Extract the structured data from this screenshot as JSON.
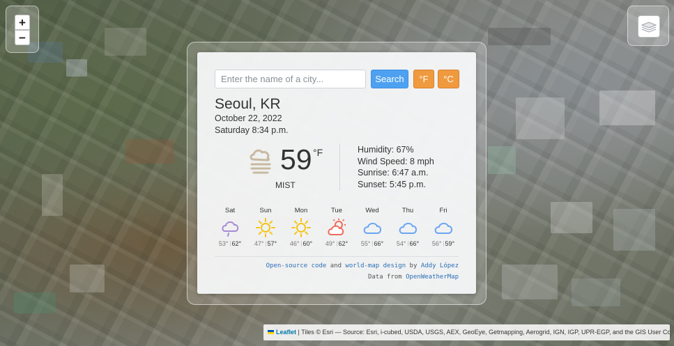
{
  "map": {
    "zoom_in": "+",
    "zoom_out": "−",
    "attribution": {
      "leaflet_label": "Leaflet",
      "text": "| Tiles © Esri — Source: Esri, i-cubed, USDA, USGS, AEX, GeoEye, Getmapping, Aerogrid, IGN, IGP, UPR-EGP, and the GIS User Community"
    }
  },
  "search": {
    "placeholder": "Enter the name of a city...",
    "value": "",
    "button_label": "Search",
    "fahrenheit_label": "°F",
    "celsius_label": "°C"
  },
  "current": {
    "city": "Seoul, KR",
    "date": "October 22, 2022",
    "time": "Saturday 8:34 p.m.",
    "temperature": "59",
    "unit": "°F",
    "description": "MIST",
    "icon": "mist-icon",
    "humidity": "Humidity: 67%",
    "wind": "Wind Speed: 8 mph",
    "sunrise": "Sunrise: 6:47 a.m.",
    "sunset": "Sunset: 5:45 p.m."
  },
  "forecast": [
    {
      "day": "Sat",
      "icon": "rain-cloud-icon",
      "low": "53°",
      "high": "62°"
    },
    {
      "day": "Sun",
      "icon": "sun-icon",
      "low": "47°",
      "high": "57°"
    },
    {
      "day": "Mon",
      "icon": "sun-icon",
      "low": "46°",
      "high": "60°"
    },
    {
      "day": "Tue",
      "icon": "partly-cloudy-icon",
      "low": "49°",
      "high": "62°"
    },
    {
      "day": "Wed",
      "icon": "cloud-icon",
      "low": "55°",
      "high": "66°"
    },
    {
      "day": "Thu",
      "icon": "cloud-icon",
      "low": "54°",
      "high": "66°"
    },
    {
      "day": "Fri",
      "icon": "cloud-icon",
      "low": "56°",
      "high": "59°"
    }
  ],
  "credits": {
    "source_code": "Open-source code",
    "and": "and",
    "design": "world-map design",
    "by": "by",
    "author": "Addy López",
    "data_from": "Data from",
    "provider": "OpenWeatherMap"
  },
  "colors": {
    "search_button": "#4ea1f0",
    "unit_buttons": "#ef9a3e",
    "mist_icon": "#c8b9a0",
    "sun_icon": "#f5c518",
    "cloud_icon": "#6aa6f2",
    "rain_icon": "#a78bd6",
    "partly_cloudy_icon": "#f06a5a"
  }
}
